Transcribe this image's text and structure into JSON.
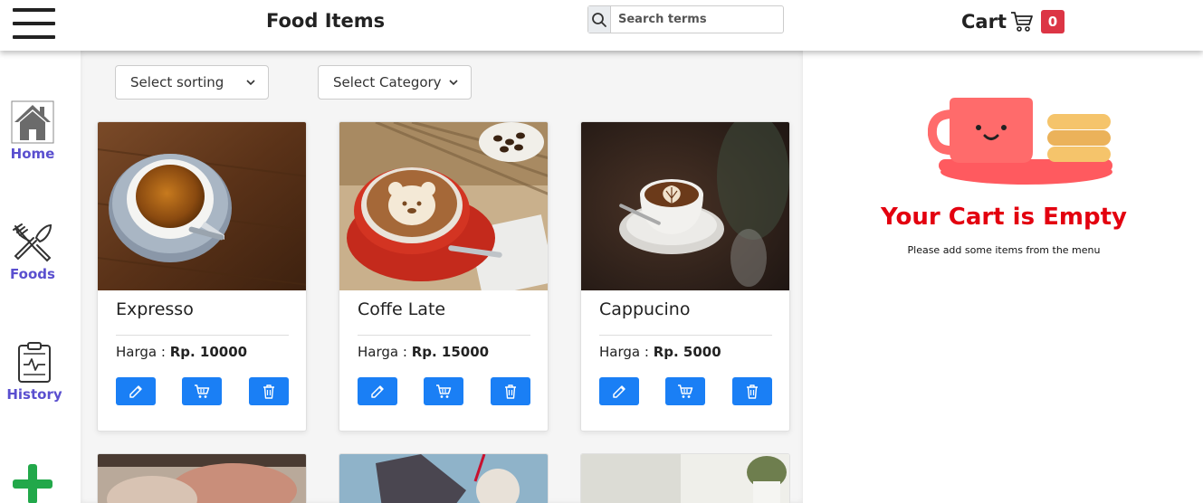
{
  "header": {
    "title": "Food Items",
    "search_placeholder": "Search terms",
    "cart_label": "Cart",
    "cart_count": "0"
  },
  "sidebar": {
    "items": [
      {
        "label": "Home",
        "icon": "home-icon"
      },
      {
        "label": "Foods",
        "icon": "fork-knife-icon"
      },
      {
        "label": "History",
        "icon": "clipboard-icon"
      },
      {
        "label": "",
        "icon": "plus-icon"
      }
    ]
  },
  "filters": {
    "sorting": "Select sorting",
    "category": "Select Category"
  },
  "products": [
    {
      "name": "Expresso",
      "price_label": "Harga : ",
      "price": "Rp. 10000"
    },
    {
      "name": "Coffe Late",
      "price_label": "Harga : ",
      "price": "Rp. 15000"
    },
    {
      "name": "Cappucino",
      "price_label": "Harga : ",
      "price": "Rp. 5000"
    }
  ],
  "cart": {
    "empty_title": "Your Cart is Empty",
    "empty_subtitle": "Please add some items from the menu"
  },
  "colors": {
    "accent": "#1a7ff5",
    "nav_label": "#5a4fcf",
    "badge": "#dc3545",
    "empty_title": "#e3000f",
    "add_icon": "#22a84a"
  }
}
